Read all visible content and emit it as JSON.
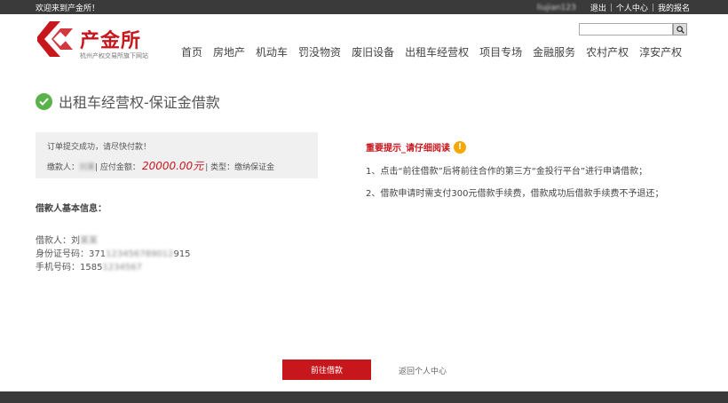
{
  "topbar": {
    "welcome": "欢迎来到产金所！",
    "username": "liujian123",
    "logout": "退出",
    "sep": "|",
    "user_center": "个人中心",
    "my_signup": "我的报名"
  },
  "logo": {
    "name": "产金所",
    "subtitle": "杭州产权交易所旗下网站",
    "brand_color": "#c8161d"
  },
  "search": {
    "value": "",
    "icon": "search-icon"
  },
  "nav": [
    "首页",
    "房地产",
    "机动车",
    "罚没物资",
    "废旧设备",
    "出租车经营权",
    "项目专场",
    "金融服务",
    "农村产权",
    "淳安产权"
  ],
  "page": {
    "title": "出租车经营权-保证金借款",
    "check_icon": "check-circle-icon"
  },
  "order": {
    "success_text": "订单提交成功，请尽快付款！",
    "payer_label": "缴款人：",
    "payer_name": "刘某",
    "payable_label": "| 应付金额：",
    "amount": "20000.00元",
    "type_text": "| 类型：缴纳保证金"
  },
  "borrower": {
    "title": "借款人基本信息：",
    "name_label": "借款人：刘",
    "name_masked": "某某",
    "id_label": "身份证号码：371",
    "id_masked": "123456789012",
    "id_tail": "915",
    "phone_label": "手机号码：1585",
    "phone_masked": "1234567"
  },
  "notice": {
    "title": "重要提示_请仔细阅读",
    "warn_icon": "exclamation-icon",
    "warn_symbol": "!",
    "items": [
      "1、点击“前往借款”后将前往合作的第三方“金投行平台”进行申请借款；",
      "2、借款申请时需支付300元借款手续费，借款成功后借款手续费不予退还；"
    ]
  },
  "actions": {
    "go_borrow": "前往借款",
    "back_user_center": "返回个人中心"
  }
}
